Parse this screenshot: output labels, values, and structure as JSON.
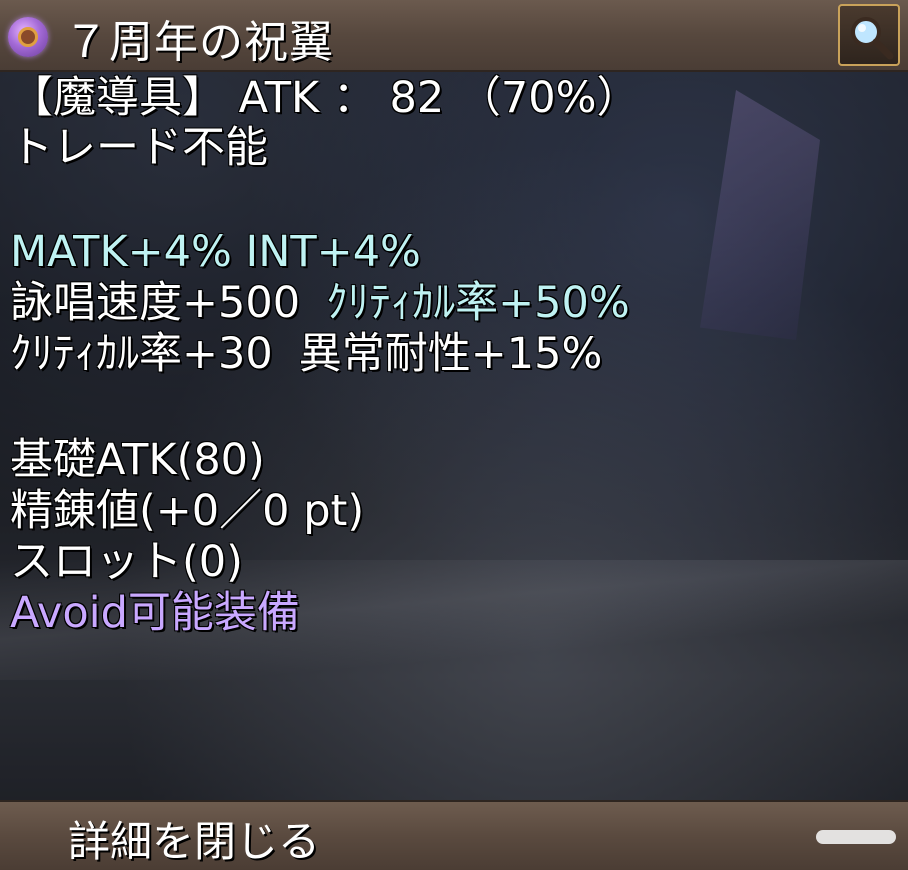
{
  "item": {
    "name": "７周年の祝翼",
    "icon": "magic-ring-icon"
  },
  "header": {
    "zoom_icon": "magnifier-icon"
  },
  "stats": {
    "type_line": "【魔導具】 ATK ： 82 （70%）",
    "trade": "トレード不能",
    "bonus_cyan_1": "MATK+4% INT+4%",
    "bonus_row2_white": "詠唱速度+500",
    "bonus_row2_cyan": "ｸﾘﾃｨｶﾙ率+50%",
    "bonus_row3_white_a": "ｸﾘﾃｨｶﾙ率+30",
    "bonus_row3_white_b": "異常耐性+15%",
    "base_atk": "基礎ATK(80)",
    "refine": "精錬値(+0／0 pt)",
    "slot": "スロット(0)",
    "avoid": "Avoid可能装備"
  },
  "footer": {
    "close_label": "詳細を閉じる"
  },
  "colors": {
    "text": "#ffffff",
    "bonus": "#bff2f2",
    "avoid": "#c9a8ff",
    "bar": "#5a4a3f"
  }
}
